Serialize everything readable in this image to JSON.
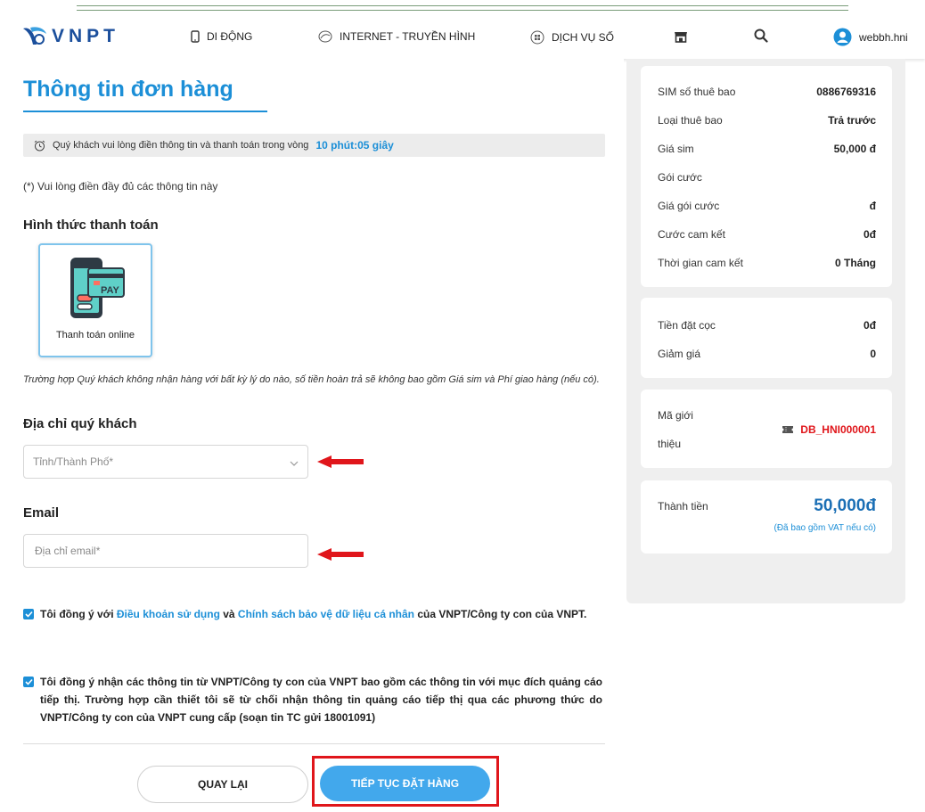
{
  "header": {
    "logo_text": "VNPT",
    "nav": {
      "mobile": "DI ĐỘNG",
      "internet": "INTERNET - TRUYỀN HÌNH",
      "digital": "DỊCH VỤ SỐ"
    },
    "username": "webbh.hni"
  },
  "page": {
    "title": "Thông tin đơn hàng",
    "timer_text": "Quý khách vui lòng điền thông tin và thanh toán trong vòng",
    "timer_value": "10 phút:05 giây",
    "required_note": "(*) Vui lòng điền đầy đủ các thông tin này",
    "payment_heading": "Hình thức thanh toán",
    "payment_option": "Thanh toán online",
    "refund_note": "Trường hợp Quý khách không nhận hàng với bất kỳ lý do nào, số tiền hoàn trả sẽ không bao gồm Giá sim và Phí giao hàng (nếu có).",
    "address_heading": "Địa chỉ quý khách",
    "province_placeholder": "Tỉnh/Thành Phố*",
    "email_heading": "Email",
    "email_placeholder": "Địa chỉ email*",
    "consent1": {
      "prefix": "Tôi đồng ý với ",
      "link1": "Điều khoản sử dụng",
      "mid": " và ",
      "link2": "Chính sách bảo vệ dữ liệu cá nhân",
      "suffix": " của VNPT/Công ty con của VNPT."
    },
    "consent2": "Tôi đồng ý nhận các thông tin từ VNPT/Công ty con của VNPT bao gồm các thông tin với mục đích quảng cáo tiếp thị. Trường hợp cần thiết tôi sẽ từ chối nhận thông tin quảng cáo tiếp thị qua các phương thức do VNPT/Công ty con của VNPT cung cấp (soạn tin TC gửi 18001091)",
    "back_button": "QUAY LẠI",
    "continue_button": "TIẾP TỤC ĐẶT HÀNG"
  },
  "summary": {
    "details": [
      {
        "label": "SIM số thuê bao",
        "value": "0886769316"
      },
      {
        "label": "Loại thuê bao",
        "value": "Trả trước"
      },
      {
        "label": "Giá sim",
        "value": "50,000 đ"
      },
      {
        "label": "Gói cước",
        "value": ""
      },
      {
        "label": "Giá gói cước",
        "value": "đ"
      },
      {
        "label": "Cước cam kết",
        "value": "0đ"
      },
      {
        "label": "Thời gian cam kết",
        "value": "0 Tháng"
      }
    ],
    "deposit": [
      {
        "label": "Tiền đặt cọc",
        "value": "0đ"
      },
      {
        "label": "Giảm giá",
        "value": "0"
      }
    ],
    "referral_label_line1": "Mã giới",
    "referral_label_line2": "thiệu",
    "referral_code": "DB_HNI000001",
    "total_label": "Thành tiền",
    "total_value": "50,000đ",
    "total_note": "(Đã bao gồm VAT nếu có)"
  },
  "colors": {
    "brand_blue": "#1c8fd7",
    "button_blue": "#42a8ec",
    "highlight_red": "#e0161b",
    "referral_red": "#e0161b"
  }
}
